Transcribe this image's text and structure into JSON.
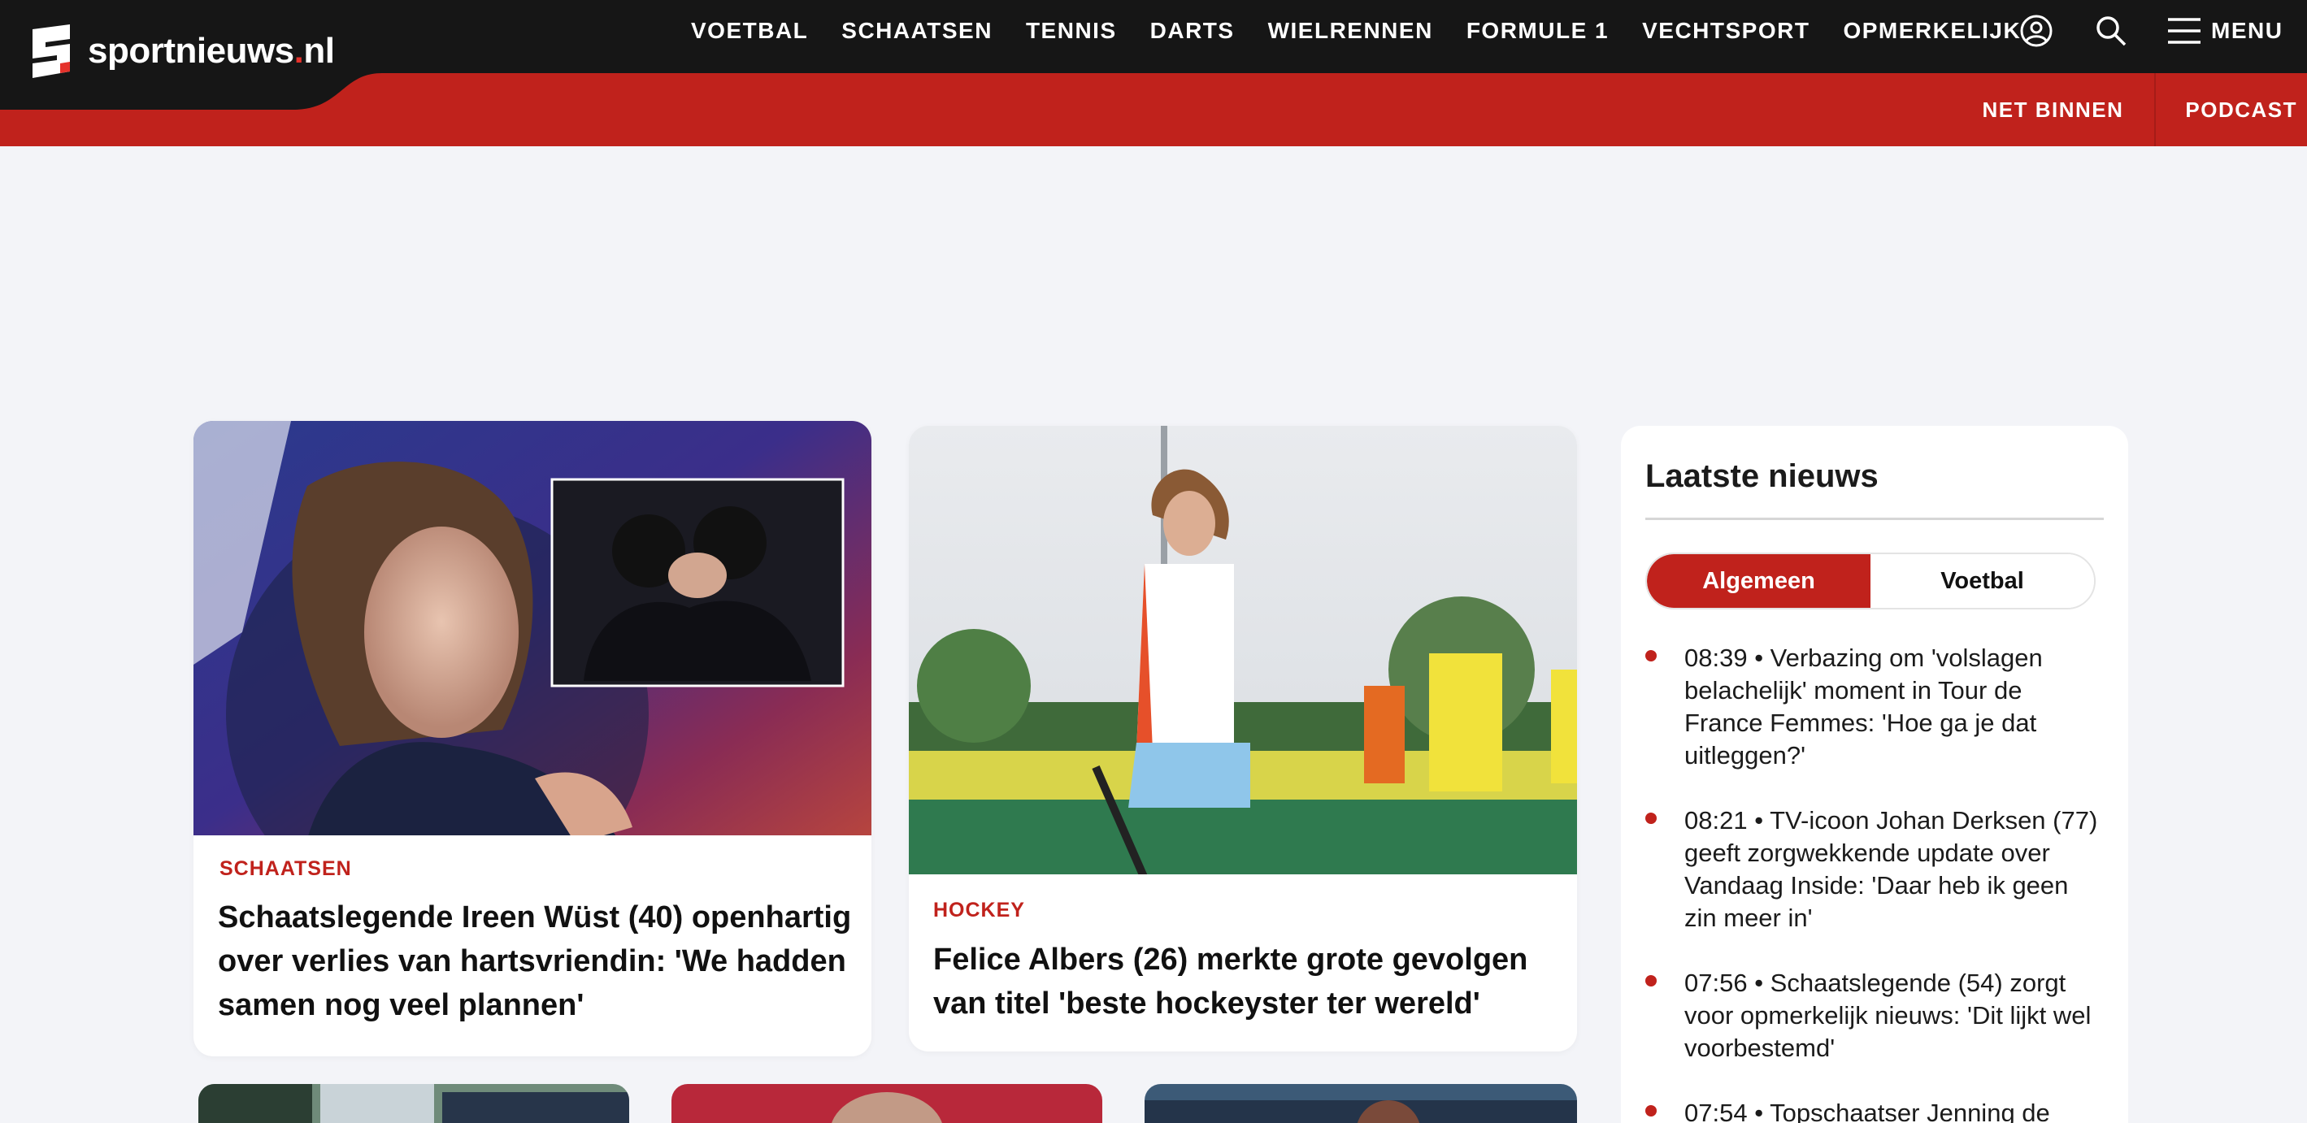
{
  "header": {
    "logo_text": "sportnieuws",
    "logo_dot": ".",
    "logo_tld": "nl",
    "nav": [
      "VOETBAL",
      "SCHAATSEN",
      "TENNIS",
      "DARTS",
      "WIELRENNEN",
      "FORMULE 1",
      "VECHTSPORT",
      "OPMERKELIJK"
    ],
    "icons": [
      "account-icon",
      "search-icon",
      "hamburger-icon"
    ],
    "menu_label": "MENU",
    "subnav": [
      "NET BINNEN",
      "PODCAST"
    ]
  },
  "colors": {
    "brand_red": "#c0221c",
    "topbar": "#161616",
    "page_bg": "#f3f4f8"
  },
  "articles": [
    {
      "tag": "SCHAATSEN",
      "title": "Schaatslegende Ireen Wüst (40) openhartig over verlies van hartsvriendin: 'We hadden samen nog veel plannen'"
    },
    {
      "tag": "HOCKEY",
      "title": "Felice Albers (26) merkte grote gevolgen van titel 'beste hockeyster ter wereld'"
    }
  ],
  "latest": {
    "title": "Laatste nieuws",
    "tabs": [
      "Algemeen",
      "Voetbal"
    ],
    "active_tab": "Algemeen",
    "items": [
      {
        "text": "08:39 • Verbazing om 'volslagen belachelijk' moment in Tour de France Femmes: 'Hoe ga je dat uitleggen?'"
      },
      {
        "text": "08:21 • TV-icoon Johan Derksen (77) geeft zorgwekkende update over Vandaag Inside: 'Daar heb ik geen zin meer in'"
      },
      {
        "text": "07:56 • Schaatslegende (54) zorgt voor opmerkelijk nieuws: 'Dit lijkt wel voorbestemd'"
      },
      {
        "text": "07:54 • Topschaatser Jenning de"
      }
    ]
  }
}
